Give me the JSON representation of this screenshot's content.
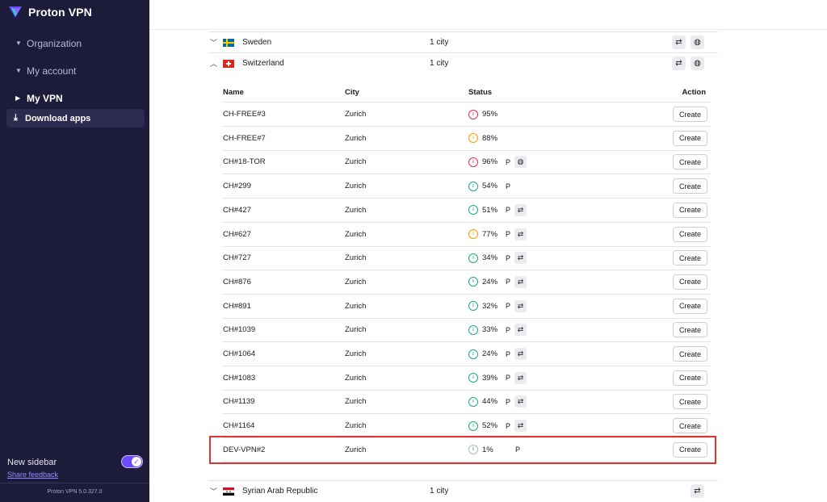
{
  "brand": {
    "name": "Proton VPN"
  },
  "sidebar": {
    "items": [
      {
        "label": "Organization"
      },
      {
        "label": "My account"
      },
      {
        "label": "My VPN"
      }
    ],
    "sub_item": {
      "label": "Download apps"
    },
    "new_sidebar_label": "New sidebar",
    "new_sidebar_enabled": true,
    "share_feedback": "Share feedback",
    "version": "Proton VPN 5.0.327.0"
  },
  "countries": [
    {
      "name": "Sweden",
      "cities": "1 city",
      "expanded": false
    },
    {
      "name": "Switzerland",
      "cities": "1 city",
      "expanded": true
    },
    {
      "name": "Syrian Arab Republic",
      "cities": "1 city",
      "expanded": false
    }
  ],
  "table": {
    "headers": {
      "name": "Name",
      "city": "City",
      "status": "Status",
      "action": "Action"
    },
    "action_label": "Create",
    "feature_p": "P",
    "rows": [
      {
        "name": "CH-FREE#3",
        "city": "Zurich",
        "load": "95%",
        "level": "high",
        "p": false,
        "tor": false,
        "swap": false
      },
      {
        "name": "CH-FREE#7",
        "city": "Zurich",
        "load": "88%",
        "level": "med",
        "p": false,
        "tor": false,
        "swap": false
      },
      {
        "name": "CH#18-TOR",
        "city": "Zurich",
        "load": "96%",
        "level": "high",
        "p": true,
        "tor": true,
        "swap": false
      },
      {
        "name": "CH#299",
        "city": "Zurich",
        "load": "54%",
        "level": "low",
        "p": true,
        "tor": false,
        "swap": false
      },
      {
        "name": "CH#427",
        "city": "Zurich",
        "load": "51%",
        "level": "low",
        "p": true,
        "tor": false,
        "swap": true
      },
      {
        "name": "CH#627",
        "city": "Zurich",
        "load": "77%",
        "level": "med",
        "p": true,
        "tor": false,
        "swap": true
      },
      {
        "name": "CH#727",
        "city": "Zurich",
        "load": "34%",
        "level": "low",
        "p": true,
        "tor": false,
        "swap": true
      },
      {
        "name": "CH#876",
        "city": "Zurich",
        "load": "24%",
        "level": "low",
        "p": true,
        "tor": false,
        "swap": true
      },
      {
        "name": "CH#891",
        "city": "Zurich",
        "load": "32%",
        "level": "low",
        "p": true,
        "tor": false,
        "swap": true
      },
      {
        "name": "CH#1039",
        "city": "Zurich",
        "load": "33%",
        "level": "low",
        "p": true,
        "tor": false,
        "swap": true
      },
      {
        "name": "CH#1064",
        "city": "Zurich",
        "load": "24%",
        "level": "low",
        "p": true,
        "tor": false,
        "swap": true
      },
      {
        "name": "CH#1083",
        "city": "Zurich",
        "load": "39%",
        "level": "low",
        "p": true,
        "tor": false,
        "swap": true
      },
      {
        "name": "CH#1139",
        "city": "Zurich",
        "load": "44%",
        "level": "low",
        "p": true,
        "tor": false,
        "swap": true
      },
      {
        "name": "CH#1164",
        "city": "Zurich",
        "load": "52%",
        "level": "low",
        "p": true,
        "tor": false,
        "swap": true
      },
      {
        "name": "DEV-VPN#2",
        "city": "Zurich",
        "load": "1%",
        "level": "vlow",
        "p": true,
        "tor": false,
        "swap": false,
        "highlighted": true
      }
    ]
  },
  "colors": {
    "sidebar_bg": "#1c1b3a",
    "accent": "#6d4aff",
    "load_high": "#dc3251",
    "load_med": "#ff9900",
    "load_low": "#1ea885",
    "highlight": "#e3312d"
  }
}
